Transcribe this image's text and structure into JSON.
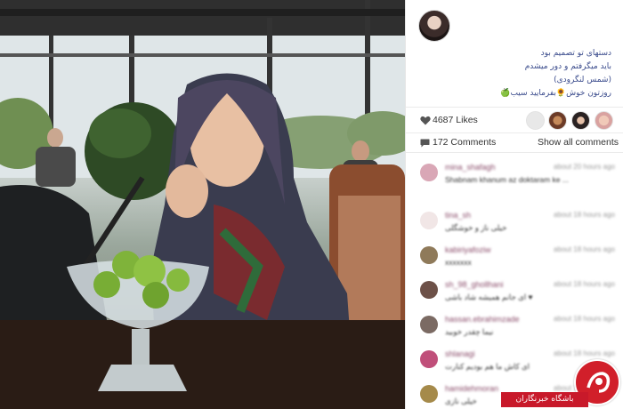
{
  "post": {
    "caption_lines": [
      "دستهای تو تصمیم بود",
      "باید میگرفتم و دور میشدم",
      "(شمس لنگرودی)",
      "روزتون خوش🌻بفرمایید سیب🍏"
    ],
    "likes": "4687 Likes",
    "comments_count": "172 Comments",
    "show_all": "Show all comments"
  },
  "icons": {
    "likes": "heart-icon",
    "comments": "speech-bubble-icon"
  },
  "comments": [
    {
      "user": "mina_shafagh",
      "time": "about 20 hours ago",
      "text": "Shabnam khanum az doktaram ke ..."
    },
    {
      "user": "tina_sh",
      "time": "about 18 hours ago",
      "text": "خیلی ناز و خوشگلی"
    },
    {
      "user": "kabiriyafoziw",
      "time": "about 18 hours ago",
      "text": "xxxxxxx"
    },
    {
      "user": "sh_98_ghollhani",
      "time": "about 18 hours ago",
      "text": "ای جانم همیشه شاد باشی ♥"
    },
    {
      "user": "hassan.ebrahimzade",
      "time": "about 18 hours ago",
      "text": "نیما چقدر خوبید"
    },
    {
      "user": "shlanagi",
      "time": "about 18 hours ago",
      "text": "ای کاش ما هم بودیم کنارت"
    },
    {
      "user": "hamidehmoran",
      "time": "about 18 hours ago",
      "text": "خیلی نازی"
    }
  ],
  "watermark": {
    "text": "باشگاه خبرنگاران"
  },
  "colors": {
    "caption": "#3a4b8c",
    "username": "#8a4c6a",
    "watermark_red": "#c8192a"
  }
}
